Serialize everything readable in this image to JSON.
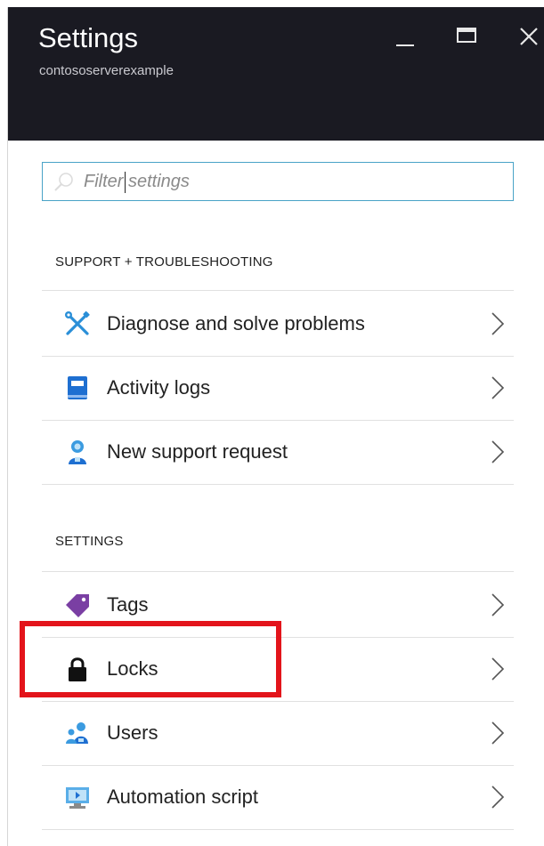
{
  "blade": {
    "title": "Settings",
    "subtitle": "contososerverexample"
  },
  "window_controls": [
    "minimize-icon",
    "maximize-icon",
    "close-icon"
  ],
  "search": {
    "placeholder": "Filter settings"
  },
  "sections": [
    {
      "header": "SUPPORT + TROUBLESHOOTING",
      "items": [
        {
          "label": "Diagnose and solve problems",
          "icon": "wrench-screwdriver-icon"
        },
        {
          "label": "Activity logs",
          "icon": "activity-log-icon"
        },
        {
          "label": "New support request",
          "icon": "support-person-icon"
        }
      ]
    },
    {
      "header": "SETTINGS",
      "items": [
        {
          "label": "Tags",
          "icon": "tag-icon"
        },
        {
          "label": "Locks",
          "icon": "lock-icon",
          "highlighted": true
        },
        {
          "label": "Users",
          "icon": "users-icon"
        },
        {
          "label": "Automation script",
          "icon": "automation-script-icon"
        }
      ]
    }
  ],
  "colors": {
    "header_bg": "#1a1a22",
    "search_border": "#49a3c7",
    "highlight": "#e3141b",
    "icon_blue": "#2a7fd4",
    "tag_purple": "#7a3fa3"
  }
}
